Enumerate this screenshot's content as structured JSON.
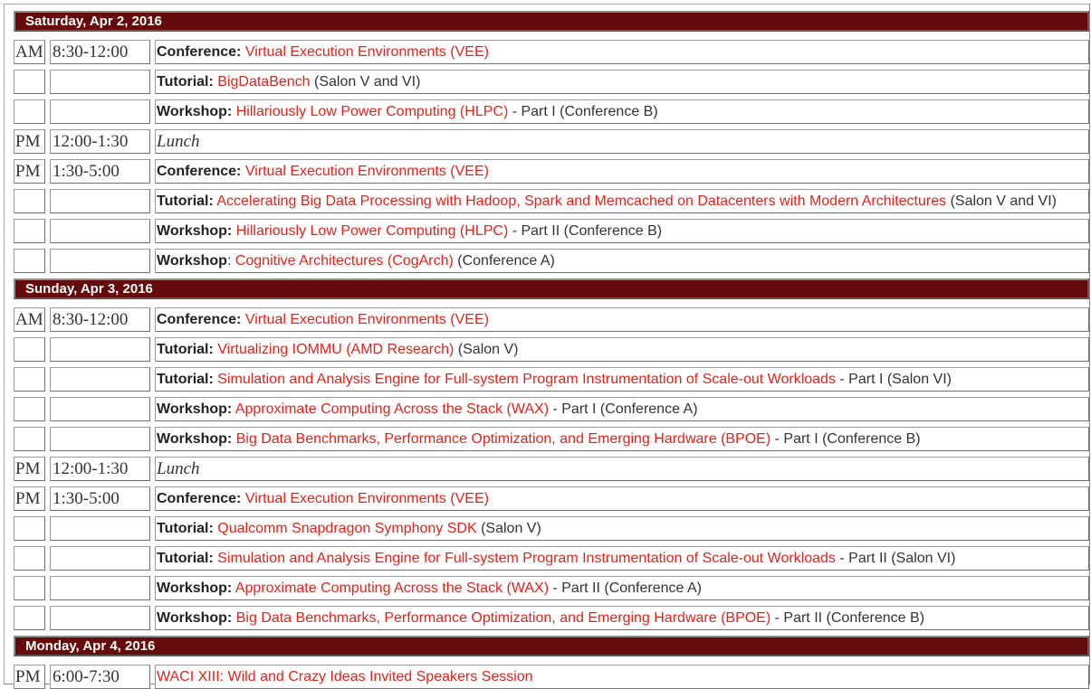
{
  "days": [
    {
      "title": "Saturday, Apr 2, 2016",
      "rows": [
        {
          "ampm": "AM",
          "time": "8:30-12:00",
          "kind": "Conference:",
          "link": "Virtual Execution Environments (VEE)",
          "extra": ""
        },
        {
          "ampm": "",
          "time": "",
          "kind": "Tutorial:",
          "link": "BigDataBench",
          "extra": " (Salon V and VI)"
        },
        {
          "ampm": "",
          "time": "",
          "kind": "Workshop:",
          "link": "Hillariously Low Power Computing (HLPC)",
          "extra": " - Part I (Conference B)"
        },
        {
          "ampm": "PM",
          "time": "12:00-1:30",
          "lunch": "Lunch"
        },
        {
          "ampm": "PM",
          "time": "1:30-5:00",
          "kind": "Conference:",
          "link": "Virtual Execution Environments (VEE)",
          "extra": ""
        },
        {
          "ampm": "",
          "time": "",
          "kind": "Tutorial:",
          "link": "Accelerating Big Data Processing with Hadoop, Spark and Memcached on Datacenters with Modern Architectures",
          "extra": " (Salon V and VI)"
        },
        {
          "ampm": "",
          "time": "",
          "kind": "Workshop:",
          "link": "Hillariously Low Power Computing (HLPC)",
          "extra": " - Part II (Conference B)"
        },
        {
          "ampm": "",
          "time": "",
          "kind": "Workshop",
          "sep": ": ",
          "link": "Cognitive Architectures (CogArch)",
          "extra": " (Conference A)"
        }
      ]
    },
    {
      "title": "Sunday, Apr 3, 2016",
      "rows": [
        {
          "ampm": "AM",
          "time": "8:30-12:00",
          "kind": "Conference:",
          "link": "Virtual Execution Environments (VEE)",
          "extra": ""
        },
        {
          "ampm": "",
          "time": "",
          "kind": "Tutorial:",
          "link": "Virtualizing IOMMU (AMD Research)",
          "extra": " (Salon V)"
        },
        {
          "ampm": "",
          "time": "",
          "kind": "Tutorial:",
          "link": "Simulation and Analysis Engine for Full-system Program Instrumentation of Scale-out Workloads",
          "extra": " - Part I (Salon VI)"
        },
        {
          "ampm": "",
          "time": "",
          "kind": "Workshop:",
          "link": "Approximate Computing Across the Stack (WAX)",
          "extra": " - Part I (Conference A)"
        },
        {
          "ampm": "",
          "time": "",
          "kind": "Workshop:",
          "link": "Big Data Benchmarks, Performance Optimization, and Emerging Hardware (BPOE)",
          "extra": " - Part I (Conference B)"
        },
        {
          "ampm": "PM",
          "time": "12:00-1:30",
          "lunch": "Lunch"
        },
        {
          "ampm": "PM",
          "time": "1:30-5:00",
          "kind": "Conference:",
          "link": "Virtual Execution Environments (VEE)",
          "extra": ""
        },
        {
          "ampm": "",
          "time": "",
          "kind": "Tutorial:",
          "link": "Qualcomm Snapdragon Symphony SDK",
          "extra": " (Salon V)"
        },
        {
          "ampm": "",
          "time": "",
          "kind": "Tutorial:",
          "link": "Simulation and Analysis Engine for Full-system Program Instrumentation of Scale-out Workloads",
          "extra": " - Part II (Salon VI)"
        },
        {
          "ampm": "",
          "time": "",
          "kind": "Workshop:",
          "link": "Approximate Computing Across the Stack (WAX)",
          "extra": " - Part II (Conference A)"
        },
        {
          "ampm": "",
          "time": "",
          "kind": "Workshop:",
          "link": "Big Data Benchmarks, Performance Optimization, and Emerging Hardware (BPOE)",
          "extra": " - Part II (Conference B)"
        }
      ]
    },
    {
      "title": "Monday, Apr 4, 2016",
      "rows": [
        {
          "ampm": "PM",
          "time": "6:00-7:30",
          "kind": "",
          "link": "WACI XIII: Wild and Crazy Ideas Invited Speakers Session",
          "extra": ""
        }
      ]
    }
  ],
  "colors": {
    "header_bg": "#650b0b",
    "link": "#e3231b",
    "text": "#333333"
  }
}
